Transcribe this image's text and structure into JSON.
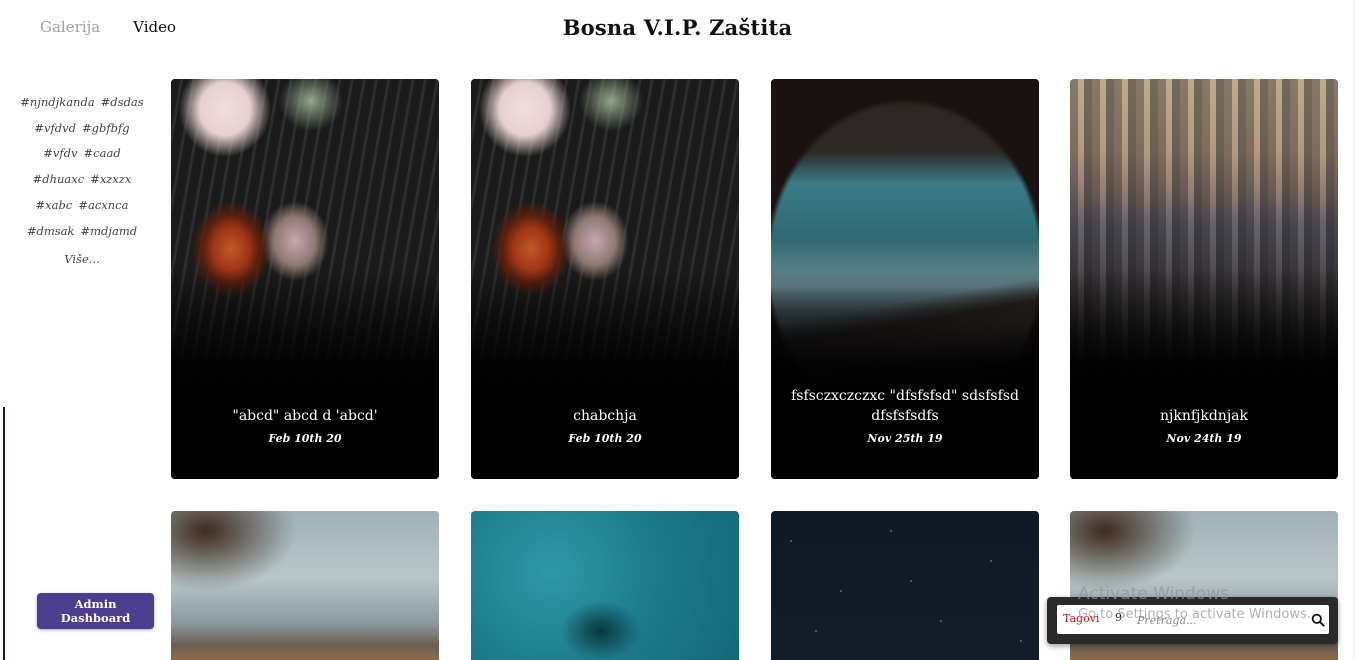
{
  "nav": {
    "gallery": "Galerija",
    "video": "Video"
  },
  "site_title": "Bosna V.I.P. Zaštita",
  "tags": [
    "#njndjkanda",
    "#dsdas",
    "#vfdvd",
    "#gbfbfg",
    "#vfdv",
    "#caad",
    "#dhuaxc",
    "#xzxzx",
    "#xabc",
    "#acxnca",
    "#dmsak",
    "#mdjamd"
  ],
  "tags_more": "Više...",
  "admin_button": "Admin Dashboard",
  "cards": [
    {
      "title": "\"abcd\" abcd d 'abcd'",
      "date": "Feb 10th 20",
      "image": "piano-flowers"
    },
    {
      "title": "chabchja",
      "date": "Feb 10th 20",
      "image": "piano-flowers"
    },
    {
      "title": "fsfsczxczczxc \"dfsfsfsd\" sdsfsfsd dfsfsfsdfs",
      "date": "Nov 25th 19",
      "image": "mountain-moon"
    },
    {
      "title": "njknfjkdnjak",
      "date": "Nov 24th 19",
      "image": "city-skyline"
    }
  ],
  "cards_row2": [
    {
      "image": "coastal-town"
    },
    {
      "image": "turquoise-water"
    },
    {
      "image": "starry-sky"
    },
    {
      "image": "coastal-town"
    }
  ],
  "search": {
    "label": "Tagovi",
    "count": "9",
    "placeholder": "Pretraga..."
  },
  "watermark": {
    "line1": "Activate Windows",
    "line2": "Go to Settings to activate Windows."
  },
  "colors": {
    "admin_button": "#4b3e8f",
    "tag_label": "#cc1111",
    "nav_inactive": "#a0a0a0"
  }
}
